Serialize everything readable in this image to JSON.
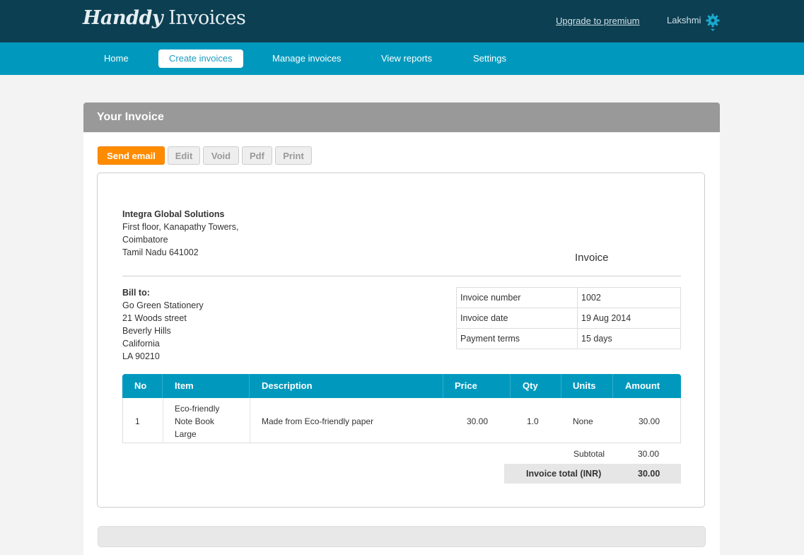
{
  "header": {
    "logo_part1": "Handdy",
    "logo_part2": "Invoices",
    "upgrade_link": "Upgrade to premium",
    "user_name": "Lakshmi"
  },
  "nav": {
    "items": [
      "Home",
      "Create invoices",
      "Manage invoices",
      "View reports",
      "Settings"
    ],
    "active": "Create invoices"
  },
  "card": {
    "title": "Your Invoice",
    "buttons": {
      "send_email": "Send email",
      "edit": "Edit",
      "void": "Void",
      "pdf": "Pdf",
      "print": "Print"
    }
  },
  "invoice": {
    "company": {
      "name": "Integra Global Solutions",
      "line1": "First floor, Kanapathy Towers,",
      "line2": "Coimbatore",
      "line3": "Tamil Nadu 641002"
    },
    "doc_title": "Invoice",
    "bill_to": {
      "label": "Bill to:",
      "name": "Go Green Stationery",
      "line1": "21 Woods street",
      "line2": "Beverly Hills",
      "line3": "California",
      "line4": "LA 90210"
    },
    "meta": {
      "number_label": "Invoice number",
      "number_value": "1002",
      "date_label": "Invoice date",
      "date_value": "19 Aug 2014",
      "terms_label": "Payment terms",
      "terms_value": "15 days"
    },
    "columns": {
      "no": "No",
      "item": "Item",
      "description": "Description",
      "price": "Price",
      "qty": "Qty",
      "units": "Units",
      "amount": "Amount"
    },
    "rows": [
      {
        "no": "1",
        "item_line1": "Eco-friendly",
        "item_line2": "Note Book",
        "item_line3": "Large",
        "description": "Made from Eco-friendly paper",
        "price": "30.00",
        "qty": "1.0",
        "units": "None",
        "amount": "30.00"
      }
    ],
    "subtotal_label": "Subtotal",
    "subtotal_value": "30.00",
    "total_label": "Invoice total (INR)",
    "total_value": "30.00"
  },
  "colors": {
    "topbar": "#0d3f52",
    "navbar": "#0099bd",
    "accent_orange": "#ff8c00"
  }
}
